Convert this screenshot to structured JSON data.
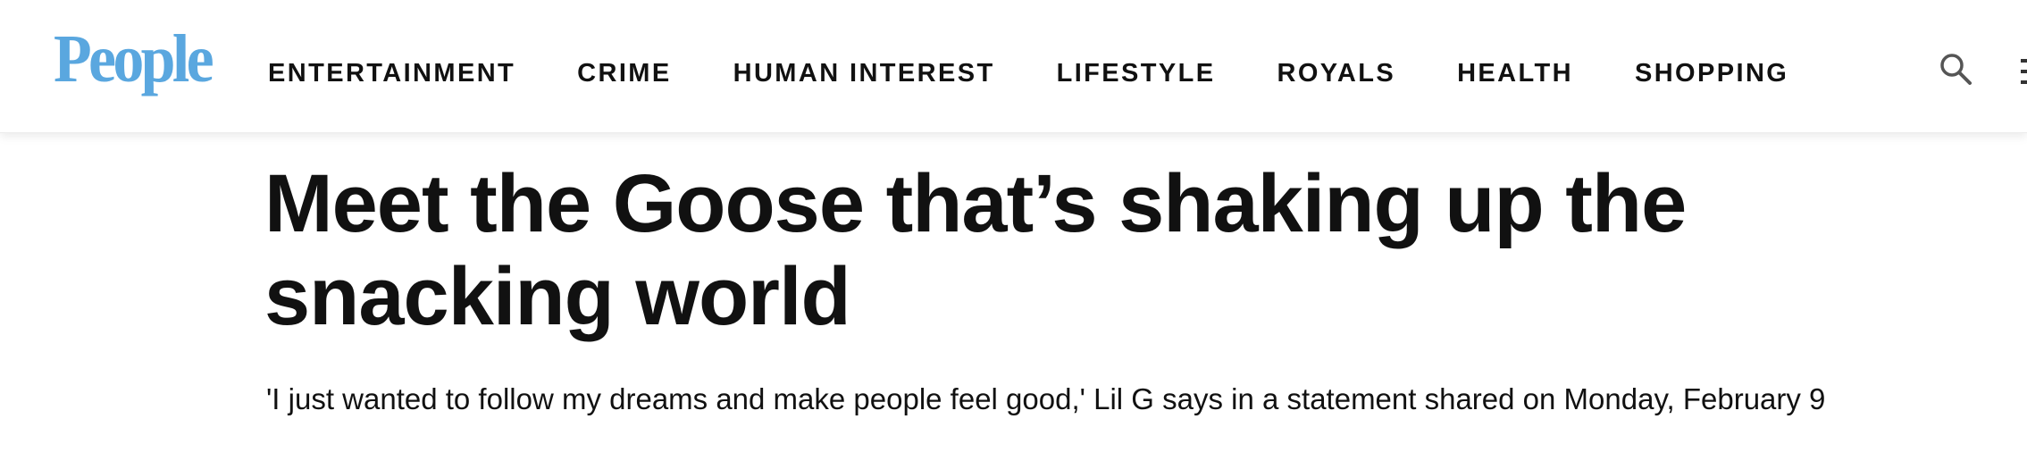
{
  "header": {
    "logo_text": "People",
    "logo_color": "#5aa7df",
    "nav": [
      {
        "label": "ENTERTAINMENT"
      },
      {
        "label": "CRIME"
      },
      {
        "label": "HUMAN INTEREST"
      },
      {
        "label": "LIFESTYLE"
      },
      {
        "label": "ROYALS"
      },
      {
        "label": "HEALTH"
      },
      {
        "label": "SHOPPING"
      }
    ],
    "search_icon": "search-icon"
  },
  "article": {
    "headline": "Meet the Goose that’s shaking up the snacking world",
    "subheadline": "'I just wanted to follow my dreams and make people feel good,' Lil G says in a statement shared on Monday, February 9"
  }
}
